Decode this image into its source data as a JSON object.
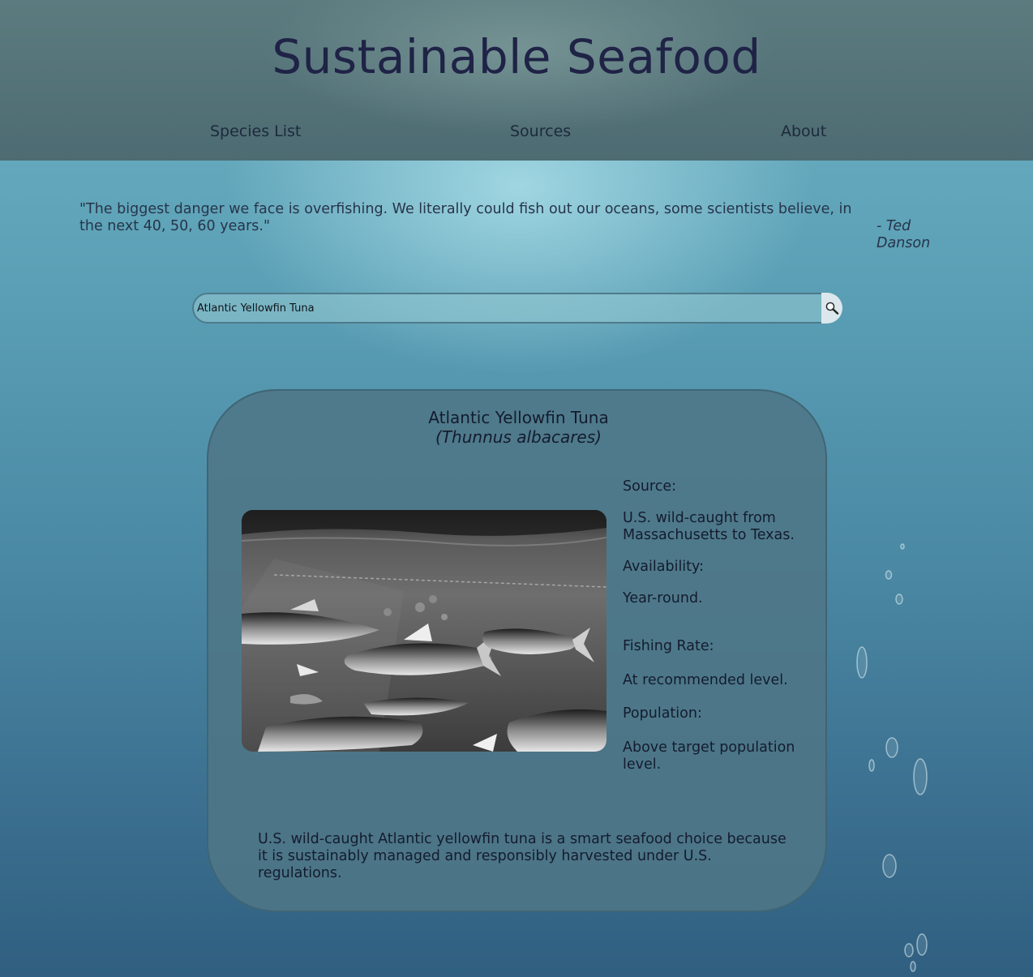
{
  "site": {
    "title": "Sustainable Seafood"
  },
  "nav": {
    "items": [
      {
        "label": "Species List"
      },
      {
        "label": "Sources"
      },
      {
        "label": "About"
      }
    ]
  },
  "quote": {
    "text": "\"The biggest danger we face is overfishing. We literally could fish out our oceans, some scientists believe, in the next 40, 50, 60 years.\"",
    "author": "- Ted Danson"
  },
  "search": {
    "value": "Atlantic Yellowfin Tuna",
    "button_icon": "magnifier-icon"
  },
  "species": {
    "common_name": "Atlantic Yellowfin Tuna",
    "scientific_name": "(Thunnus albacares)",
    "facts": [
      {
        "label": "Source:",
        "value": "U.S. wild-caught from Massachusetts to Texas."
      },
      {
        "label": "Availability:",
        "value": "Year-round."
      },
      {
        "label": "Fishing Rate:",
        "value": "At recommended level."
      },
      {
        "label": "Population:",
        "value": "Above target population level."
      }
    ],
    "summary": "U.S. wild-caught Atlantic yellowfin tuna is a smart seafood choice because it is sustainably managed and responsibly harvested under U.S. regulations."
  },
  "colors": {
    "title": "#1f2346",
    "card_background": "#4e7686",
    "header_background": "#5c7b7f"
  }
}
